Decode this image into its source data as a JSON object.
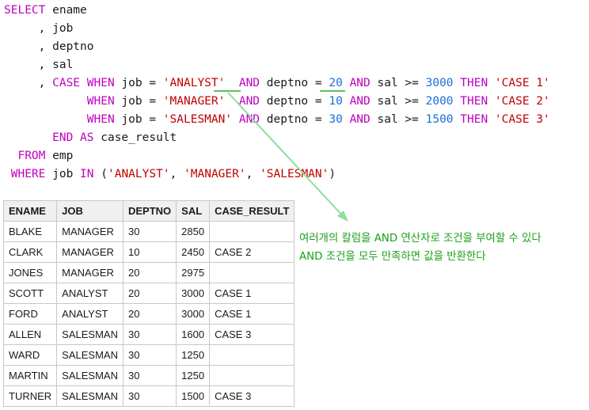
{
  "sql": {
    "lines": [
      [
        {
          "t": "SELECT",
          "k": "kw"
        },
        {
          "t": " ename",
          "k": "id"
        }
      ],
      [
        {
          "t": "     , job",
          "k": "id"
        }
      ],
      [
        {
          "t": "     , deptno",
          "k": "id"
        }
      ],
      [
        {
          "t": "     , sal",
          "k": "id"
        }
      ],
      [
        {
          "t": "     , ",
          "k": "id"
        },
        {
          "t": "CASE",
          "k": "kw"
        },
        {
          "t": " ",
          "k": "id"
        },
        {
          "t": "WHEN",
          "k": "kw"
        },
        {
          "t": " job = ",
          "k": "id"
        },
        {
          "t": "'ANALYST'",
          "k": "str"
        },
        {
          "t": "  ",
          "k": "id"
        },
        {
          "t": "AND",
          "k": "kw"
        },
        {
          "t": " deptno = ",
          "k": "id"
        },
        {
          "t": "20",
          "k": "num"
        },
        {
          "t": " ",
          "k": "id"
        },
        {
          "t": "AND",
          "k": "kw"
        },
        {
          "t": " sal >= ",
          "k": "id"
        },
        {
          "t": "3000",
          "k": "num"
        },
        {
          "t": " ",
          "k": "id"
        },
        {
          "t": "THEN",
          "k": "kw"
        },
        {
          "t": " ",
          "k": "id"
        },
        {
          "t": "'CASE 1'",
          "k": "str"
        }
      ],
      [
        {
          "t": "            ",
          "k": "id"
        },
        {
          "t": "WHEN",
          "k": "kw"
        },
        {
          "t": " job = ",
          "k": "id"
        },
        {
          "t": "'MANAGER'",
          "k": "str"
        },
        {
          "t": "  ",
          "k": "id"
        },
        {
          "t": "AND",
          "k": "kw"
        },
        {
          "t": " deptno = ",
          "k": "id"
        },
        {
          "t": "10",
          "k": "num"
        },
        {
          "t": " ",
          "k": "id"
        },
        {
          "t": "AND",
          "k": "kw"
        },
        {
          "t": " sal >= ",
          "k": "id"
        },
        {
          "t": "2000",
          "k": "num"
        },
        {
          "t": " ",
          "k": "id"
        },
        {
          "t": "THEN",
          "k": "kw"
        },
        {
          "t": " ",
          "k": "id"
        },
        {
          "t": "'CASE 2'",
          "k": "str"
        }
      ],
      [
        {
          "t": "            ",
          "k": "id"
        },
        {
          "t": "WHEN",
          "k": "kw"
        },
        {
          "t": " job = ",
          "k": "id"
        },
        {
          "t": "'SALESMAN'",
          "k": "str"
        },
        {
          "t": " ",
          "k": "id"
        },
        {
          "t": "AND",
          "k": "kw"
        },
        {
          "t": " deptno = ",
          "k": "id"
        },
        {
          "t": "30",
          "k": "num"
        },
        {
          "t": " ",
          "k": "id"
        },
        {
          "t": "AND",
          "k": "kw"
        },
        {
          "t": " sal >= ",
          "k": "id"
        },
        {
          "t": "1500",
          "k": "num"
        },
        {
          "t": " ",
          "k": "id"
        },
        {
          "t": "THEN",
          "k": "kw"
        },
        {
          "t": " ",
          "k": "id"
        },
        {
          "t": "'CASE 3'",
          "k": "str"
        }
      ],
      [
        {
          "t": "       ",
          "k": "id"
        },
        {
          "t": "END",
          "k": "kw"
        },
        {
          "t": " ",
          "k": "id"
        },
        {
          "t": "AS",
          "k": "kw"
        },
        {
          "t": " case_result",
          "k": "id"
        }
      ],
      [
        {
          "t": "  ",
          "k": "id"
        },
        {
          "t": "FROM",
          "k": "kw"
        },
        {
          "t": " emp",
          "k": "id"
        }
      ],
      [
        {
          "t": " ",
          "k": "id"
        },
        {
          "t": "WHERE",
          "k": "kw"
        },
        {
          "t": " job ",
          "k": "id"
        },
        {
          "t": "IN",
          "k": "kw"
        },
        {
          "t": " (",
          "k": "id"
        },
        {
          "t": "'ANALYST'",
          "k": "str"
        },
        {
          "t": ", ",
          "k": "id"
        },
        {
          "t": "'MANAGER'",
          "k": "str"
        },
        {
          "t": ", ",
          "k": "id"
        },
        {
          "t": "'SALESMAN'",
          "k": "str"
        },
        {
          "t": ")",
          "k": "id"
        }
      ]
    ]
  },
  "annotation": {
    "line1": "여러개의 칼럼을 AND 연산자로 조건을 부여할 수 있다",
    "line2": "AND 조건을 모두 만족하면 값을 반환한다"
  },
  "colors": {
    "keyword": "#c000c0",
    "string": "#c00000",
    "number": "#1c6ed6",
    "annotation": "#1aa01a",
    "arrow": "#90dd9c"
  },
  "result": {
    "columns": [
      "ENAME",
      "JOB",
      "DEPTNO",
      "SAL",
      "CASE_RESULT"
    ],
    "rows": [
      [
        "BLAKE",
        "MANAGER",
        "30",
        "2850",
        ""
      ],
      [
        "CLARK",
        "MANAGER",
        "10",
        "2450",
        "CASE 2"
      ],
      [
        "JONES",
        "MANAGER",
        "20",
        "2975",
        ""
      ],
      [
        "SCOTT",
        "ANALYST",
        "20",
        "3000",
        "CASE 1"
      ],
      [
        "FORD",
        "ANALYST",
        "20",
        "3000",
        "CASE 1"
      ],
      [
        "ALLEN",
        "SALESMAN",
        "30",
        "1600",
        "CASE 3"
      ],
      [
        "WARD",
        "SALESMAN",
        "30",
        "1250",
        ""
      ],
      [
        "MARTIN",
        "SALESMAN",
        "30",
        "1250",
        ""
      ],
      [
        "TURNER",
        "SALESMAN",
        "30",
        "1500",
        "CASE 3"
      ]
    ]
  }
}
